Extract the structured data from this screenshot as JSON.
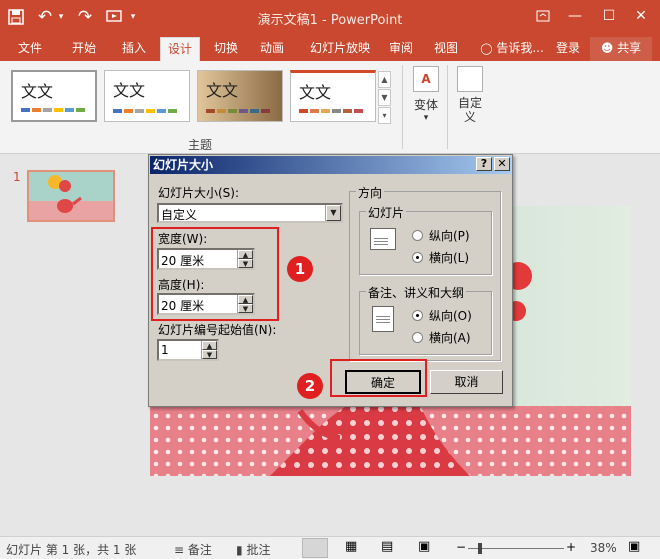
{
  "titlebar": {
    "title": "演示文稿1 - PowerPoint",
    "qa_save_icon": "save-icon",
    "qa_undo": "↶",
    "qa_redo": "↷",
    "qa_more": "▾",
    "min": "—",
    "max": "☐",
    "close": "✕"
  },
  "tabs": [
    {
      "label": "文件"
    },
    {
      "label": "开始"
    },
    {
      "label": "插入"
    },
    {
      "label": "设计"
    },
    {
      "label": "切换"
    },
    {
      "label": "动画"
    },
    {
      "label": "幻灯片放映"
    },
    {
      "label": "审阅"
    },
    {
      "label": "视图"
    }
  ],
  "tell_me": "告诉我...",
  "login": "登录",
  "share": "共享",
  "ribbon": {
    "theme_sample": "文文",
    "themes_group_label": "主题",
    "variants_label": "变体",
    "customize_label": "自定义",
    "dropdown_arrow": "▾"
  },
  "thumbs": {
    "slide_number": "1"
  },
  "dialog": {
    "title": "幻灯片大小",
    "help": "?",
    "close": "✕",
    "size_label": "幻灯片大小(S):",
    "size_value": "自定义",
    "width_label": "宽度(W):",
    "width_value": "20 厘米",
    "height_label": "高度(H):",
    "height_value": "20 厘米",
    "start_label": "幻灯片编号起始值(N):",
    "start_value": "1",
    "orientation_label": "方向",
    "slides_group": "幻灯片",
    "notes_group": "备注、讲义和大纲",
    "portrait_p": "纵向(P)",
    "landscape_l": "横向(L)",
    "portrait_o": "纵向(O)",
    "landscape_a": "横向(A)",
    "ok": "确定",
    "cancel": "取消"
  },
  "annotations": {
    "one": "1",
    "two": "2"
  },
  "status": {
    "slide_info": "幻灯片 第 1 张，共 1 张",
    "notes": "备注",
    "comments": "批注",
    "zoom": "38%",
    "minus": "−",
    "plus": "+"
  },
  "colors": {
    "accent": "#c9482f",
    "annotation_red": "#e02020",
    "dialog_title_start": "#0a246a"
  }
}
